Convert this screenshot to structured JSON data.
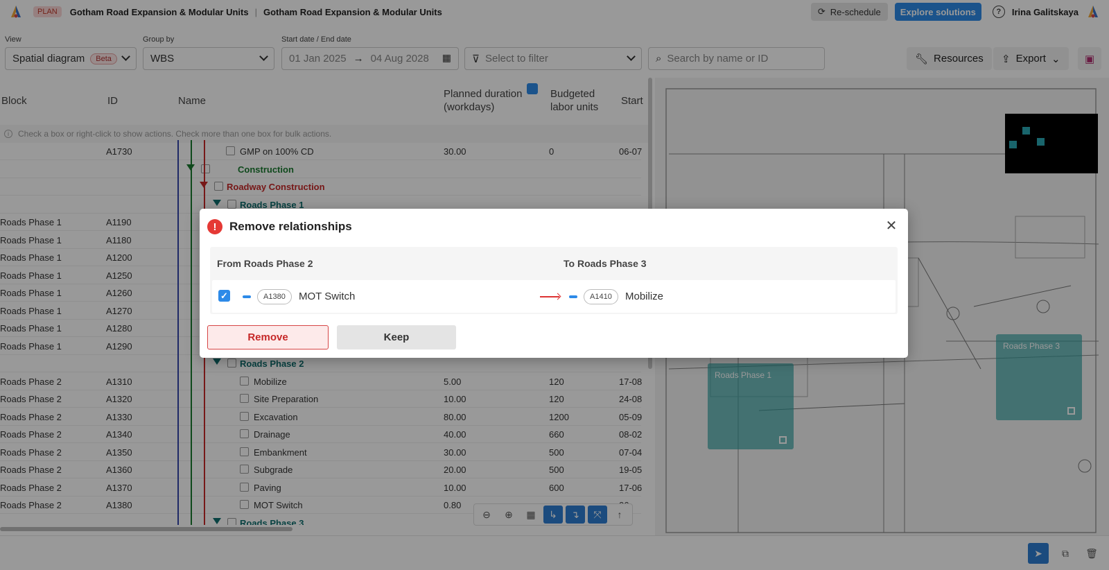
{
  "header": {
    "badge": "PLAN",
    "project_title": "Gotham Road Expansion & Modular Units",
    "project_subtitle": "Gotham Road Expansion & Modular Units",
    "reschedule_label": "Re-schedule",
    "explore_label": "Explore solutions",
    "help_glyph": "?",
    "user_name": "Irina Galitskaya"
  },
  "filters": {
    "view_label": "View",
    "view_value": "Spatial diagram",
    "view_badge": "Beta",
    "group_label": "Group by",
    "group_value": "WBS",
    "dates_label": "Start date / End date",
    "start_date": "01 Jan 2025",
    "date_arrow": "→",
    "end_date": "04 Aug 2028",
    "filter_placeholder": "Select to filter",
    "search_placeholder": "Search by name or ID",
    "resources_label": "Resources",
    "export_label": "Export"
  },
  "table": {
    "columns": {
      "block": "Block",
      "id": "ID",
      "name": "Name",
      "duration": "Planned duration (workdays)",
      "labor": "Budgeted labor units",
      "start": "Start"
    },
    "info_text": "Check a box or right-click to show actions. Check more than one box for bulk actions.",
    "rows": [
      {
        "block": "",
        "id": "A1730",
        "name": "GMP on 100% CD",
        "duration": "30.00",
        "labor": "0",
        "start": "06-07"
      },
      {
        "block": "",
        "id": "",
        "name": "Construction",
        "duration": "",
        "labor": "",
        "start": ""
      },
      {
        "block": "",
        "id": "",
        "name": "Roadway Construction",
        "duration": "",
        "labor": "",
        "start": ""
      },
      {
        "block": "",
        "id": "",
        "name": "Roads Phase 1",
        "duration": "",
        "labor": "",
        "start": ""
      },
      {
        "block": "Roads Phase 1",
        "id": "A1190",
        "name": "",
        "duration": "",
        "labor": "",
        "start": ""
      },
      {
        "block": "Roads Phase 1",
        "id": "A1180",
        "name": "",
        "duration": "",
        "labor": "",
        "start": ""
      },
      {
        "block": "Roads Phase 1",
        "id": "A1200",
        "name": "",
        "duration": "",
        "labor": "",
        "start": ""
      },
      {
        "block": "Roads Phase 1",
        "id": "A1250",
        "name": "",
        "duration": "",
        "labor": "",
        "start": ""
      },
      {
        "block": "Roads Phase 1",
        "id": "A1260",
        "name": "",
        "duration": "",
        "labor": "",
        "start": ""
      },
      {
        "block": "Roads Phase 1",
        "id": "A1270",
        "name": "",
        "duration": "",
        "labor": "",
        "start": ""
      },
      {
        "block": "Roads Phase 1",
        "id": "A1280",
        "name": "",
        "duration": "",
        "labor": "",
        "start": ""
      },
      {
        "block": "Roads Phase 1",
        "id": "A1290",
        "name": "",
        "duration": "",
        "labor": "",
        "start": ""
      },
      {
        "block": "",
        "id": "",
        "name": "Roads Phase 2",
        "duration": "",
        "labor": "",
        "start": ""
      },
      {
        "block": "Roads Phase 2",
        "id": "A1310",
        "name": "Mobilize",
        "duration": "5.00",
        "labor": "120",
        "start": "17-08"
      },
      {
        "block": "Roads Phase 2",
        "id": "A1320",
        "name": "Site Preparation",
        "duration": "10.00",
        "labor": "120",
        "start": "24-08"
      },
      {
        "block": "Roads Phase 2",
        "id": "A1330",
        "name": "Excavation",
        "duration": "80.00",
        "labor": "1200",
        "start": "05-09"
      },
      {
        "block": "Roads Phase 2",
        "id": "A1340",
        "name": "Drainage",
        "duration": "40.00",
        "labor": "660",
        "start": "08-02"
      },
      {
        "block": "Roads Phase 2",
        "id": "A1350",
        "name": "Embankment",
        "duration": "30.00",
        "labor": "500",
        "start": "07-04"
      },
      {
        "block": "Roads Phase 2",
        "id": "A1360",
        "name": "Subgrade",
        "duration": "20.00",
        "labor": "500",
        "start": "19-05"
      },
      {
        "block": "Roads Phase 2",
        "id": "A1370",
        "name": "Paving",
        "duration": "10.00",
        "labor": "600",
        "start": "17-06"
      },
      {
        "block": "Roads Phase 2",
        "id": "A1380",
        "name": "MOT Switch",
        "duration": "0.80",
        "labor": "",
        "start": "06"
      },
      {
        "block": "",
        "id": "",
        "name": "Roads Phase 3",
        "duration": "",
        "labor": "",
        "start": ""
      }
    ]
  },
  "map": {
    "zones": [
      {
        "label": "Roads Phase 1"
      },
      {
        "label": "Roads Phase 3"
      }
    ]
  },
  "modal": {
    "title": "Remove relationships",
    "warn_glyph": "!",
    "close_glyph": "✕",
    "from_label": "From Roads Phase 2",
    "to_label": "To Roads Phase 3",
    "from_id": "A1380",
    "from_name": "MOT Switch",
    "to_id": "A1410",
    "to_name": "Mobilize",
    "check_glyph": "✓",
    "remove_label": "Remove",
    "keep_label": "Keep"
  },
  "colors": {
    "accent": "#2d8ae8",
    "danger": "#e53935",
    "construction_green": "#1a7a30",
    "roadway_red": "#c62828",
    "phase_teal": "#0e6e6e",
    "zone": "#2aa0a0"
  }
}
